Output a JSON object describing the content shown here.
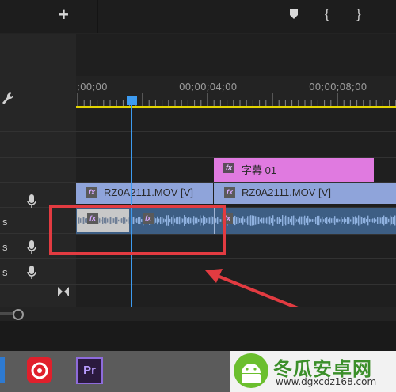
{
  "toolbar": {
    "add_icon": "+",
    "marker_icon": "marker",
    "in_point": "{",
    "out_point": "}"
  },
  "ruler": {
    "timecodes": [
      ";00;00",
      "00;00;04;00",
      "00;00;08;00"
    ]
  },
  "tracks": {
    "audio_labels": [
      "s",
      "s",
      "s"
    ]
  },
  "clips": {
    "title_clip": {
      "fx": "fx",
      "label": "字幕 01"
    },
    "video_clip_1": {
      "fx": "fx",
      "label": "RZ0A2111.MOV [V]"
    },
    "video_clip_2": {
      "fx": "fx",
      "label": "RZ0A2111.MOV [V]"
    },
    "audio_fx": "fx"
  },
  "taskbar": {
    "pr_label": "Pr"
  },
  "watermark": {
    "title": "冬瓜安卓网",
    "url": "www.dgxcdz168.com"
  },
  "colors": {
    "playhead": "#3d9bf0",
    "title_clip": "#e07ae0",
    "video_clip": "#8fa4da",
    "annotation": "#e23b41",
    "work_area": "#e3d400"
  }
}
